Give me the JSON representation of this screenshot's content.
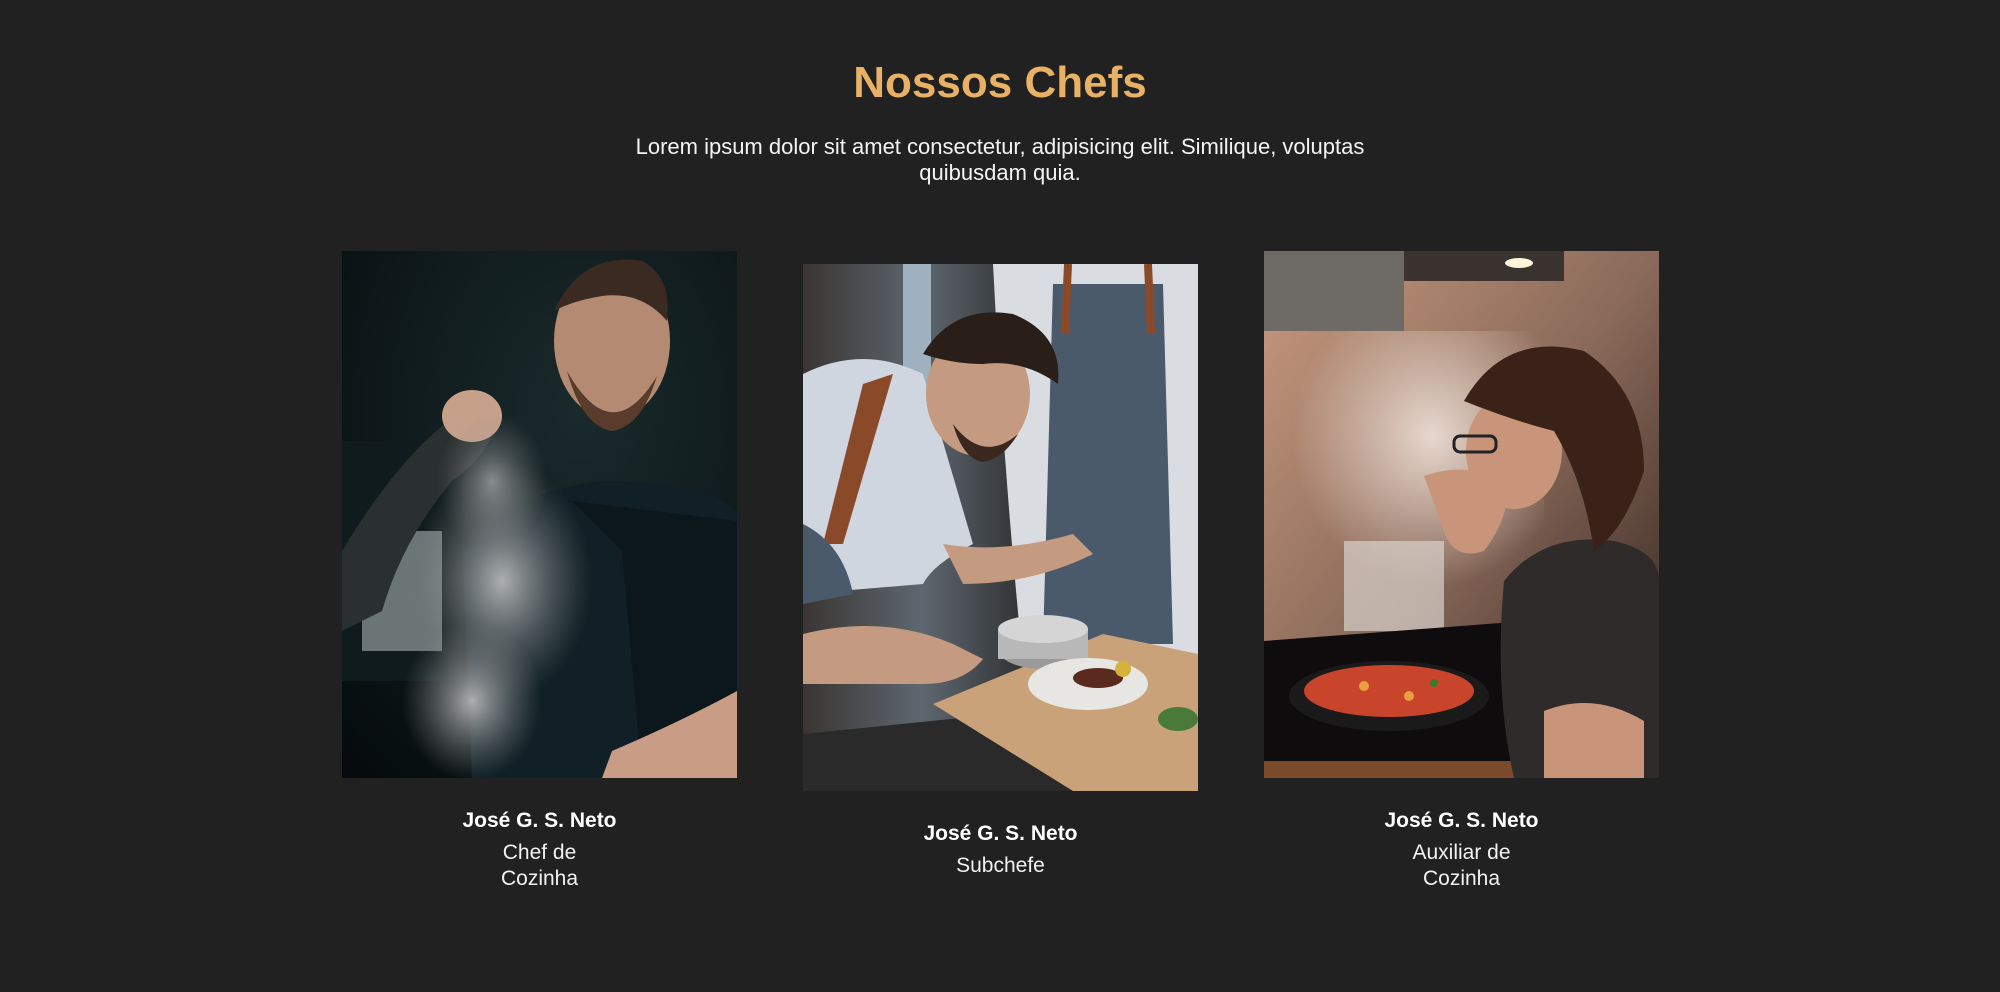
{
  "section": {
    "title": "Nossos Chefs",
    "subtitle": "Lorem ipsum dolor sit amet consectetur, adipisicing elit. Similique, voluptas quibusdam quia."
  },
  "colors": {
    "background": "#212121",
    "accent": "#e9b165",
    "text": "#ffffff"
  },
  "chefs": [
    {
      "name": "José G. S. Neto",
      "role_lines": [
        "Chef de",
        "Cozinha"
      ],
      "photo": "chef-seasoning-steam-photo"
    },
    {
      "name": "José G. S. Neto",
      "role_lines": [
        "Subchefe"
      ],
      "photo": "chef-plating-dish-photo"
    },
    {
      "name": "José G. S. Neto",
      "role_lines": [
        "Auxiliar de",
        "Cozinha"
      ],
      "photo": "chef-tasting-food-photo"
    }
  ]
}
